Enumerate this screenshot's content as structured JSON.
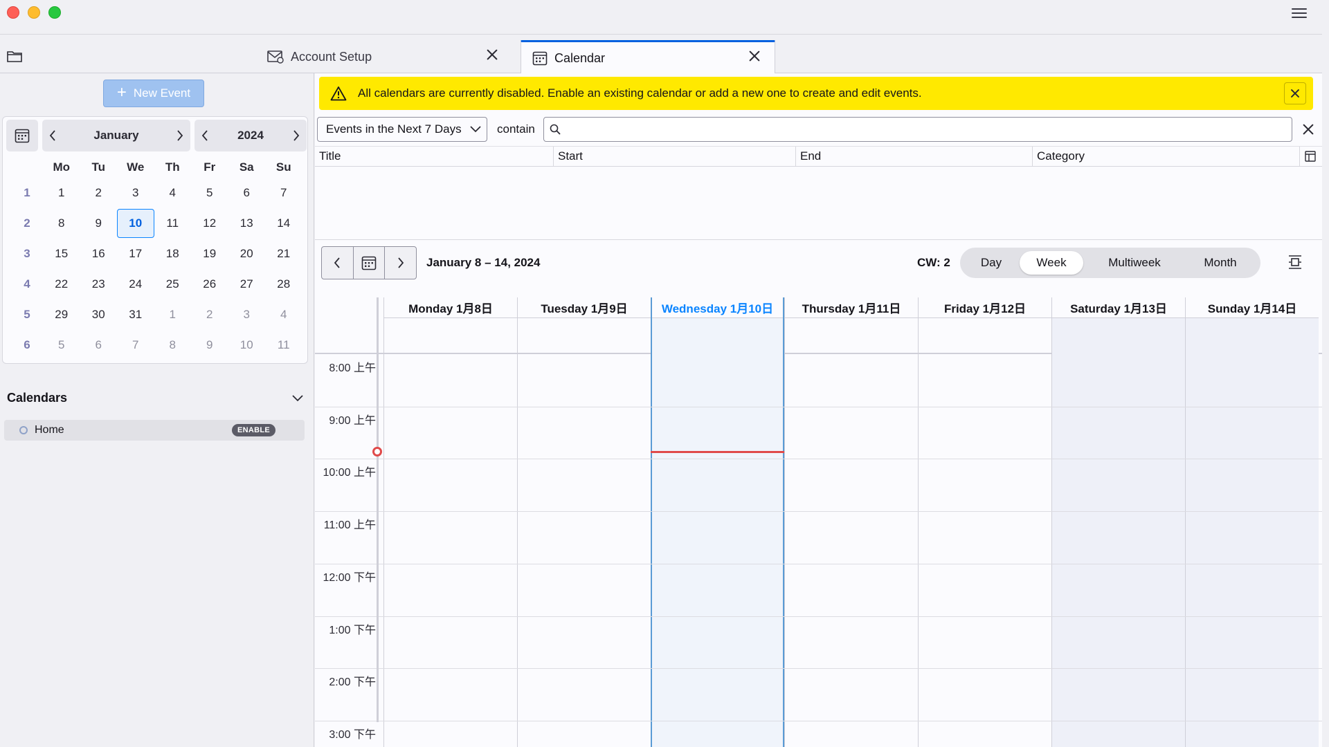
{
  "app": {
    "accent": "#0060df",
    "warning_bg": "#ffe900"
  },
  "tabs": [
    {
      "label": "Account Setup",
      "icon": "mail-setup-icon"
    },
    {
      "label": "Calendar",
      "icon": "calendar-icon",
      "active": true
    }
  ],
  "sidebar": {
    "new_event_label": "New Event",
    "mini_calendar": {
      "month": "January",
      "year": "2024",
      "weekdays": [
        "Mo",
        "Tu",
        "We",
        "Th",
        "Fr",
        "Sa",
        "Su"
      ],
      "weeks": [
        {
          "num": "1",
          "days": [
            "1",
            "2",
            "3",
            "4",
            "5",
            "6",
            "7"
          ]
        },
        {
          "num": "2",
          "days": [
            "8",
            "9",
            "10",
            "11",
            "12",
            "13",
            "14"
          ]
        },
        {
          "num": "3",
          "days": [
            "15",
            "16",
            "17",
            "18",
            "19",
            "20",
            "21"
          ]
        },
        {
          "num": "4",
          "days": [
            "22",
            "23",
            "24",
            "25",
            "26",
            "27",
            "28"
          ]
        },
        {
          "num": "5",
          "days": [
            "29",
            "30",
            "31",
            "1",
            "2",
            "3",
            "4"
          ]
        },
        {
          "num": "6",
          "days": [
            "5",
            "6",
            "7",
            "8",
            "9",
            "10",
            "11"
          ]
        }
      ],
      "today": "10"
    },
    "calendars_title": "Calendars",
    "calendars": [
      {
        "name": "Home",
        "badge": "ENABLE"
      }
    ]
  },
  "main": {
    "warning_text": "All calendars are currently disabled. Enable an existing calendar or add a new one to create and edit events.",
    "filter": {
      "selected": "Events in the Next 7 Days",
      "contain_label": "contain",
      "search_value": ""
    },
    "list_columns": [
      "Title",
      "Start",
      "End",
      "Category"
    ],
    "week": {
      "range": "January 8 – 14, 2024",
      "cw": "CW: 2",
      "views": [
        "Day",
        "Week",
        "Multiweek",
        "Month"
      ],
      "selected_view": "Week",
      "days": [
        "Monday 1月8日",
        "Tuesday 1月9日",
        "Wednesday 1月10日",
        "Thursday 1月11日",
        "Friday 1月12日",
        "Saturday 1月13日",
        "Sunday 1月14日"
      ],
      "hours": [
        "8:00 上午",
        "9:00 上午",
        "10:00 上午",
        "11:00 上午",
        "12:00 下午",
        "1:00 下午",
        "2:00 下午",
        "3:00 下午"
      ]
    }
  }
}
